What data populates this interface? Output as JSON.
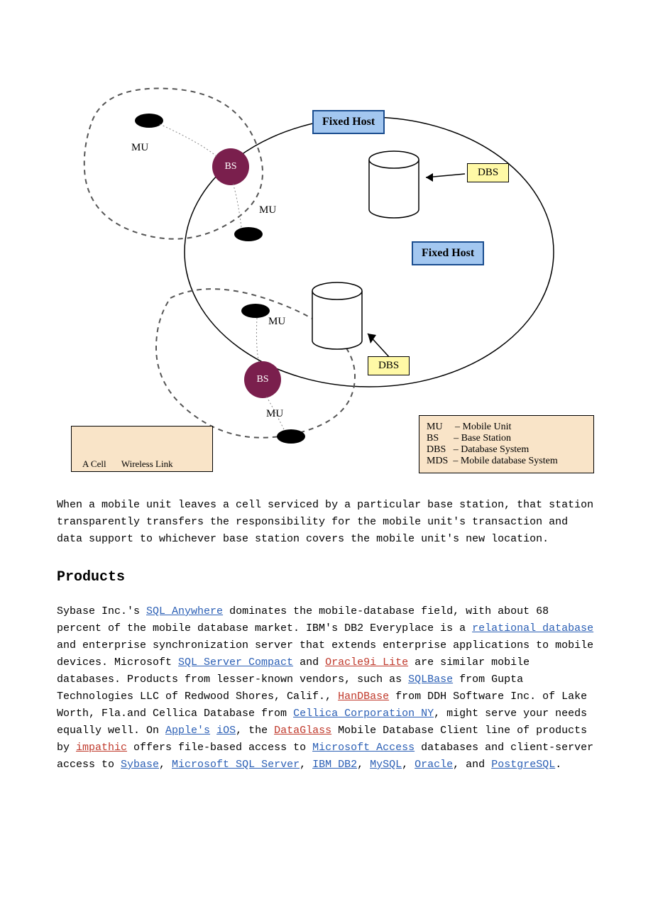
{
  "diagram": {
    "fixed_host": "Fixed Host",
    "mu": "MU",
    "bs": "BS",
    "dbs": "DBS",
    "legend_left": {
      "cell": "A Cell",
      "wireless": "Wireless Link"
    },
    "legend_right": {
      "mu": "MU     – Mobile Unit",
      "bs": "BS      – Base Station",
      "dbs": "DBS   – Database System",
      "mds": "MDS  – Mobile database System"
    }
  },
  "para1": "When a mobile unit leaves a cell serviced by a particular base station, that station transparently transfers the responsibility for the mobile unit's transaction and data support to whichever base station covers the mobile unit's new location.",
  "heading": "Products",
  "para2": {
    "t1": "Sybase Inc.'s ",
    "l1": "SQL Anywhere",
    "t2": " dominates the mobile-database field, with about 68 percent of the mobile database market. IBM's DB2 Everyplace is a ",
    "l2": "relational database",
    "t3": " and enterprise synchronization server that extends enterprise applications to mobile devices. Microsoft ",
    "l3": "SQL Server Compact",
    "t4": " and ",
    "l4": "Oracle9i Lite",
    "t5": " are similar mobile databases. Products from lesser-known vendors, such as ",
    "l5": "SQLBase",
    "t6": " from Gupta Technologies LLC of Redwood Shores, Calif., ",
    "l6": "HanDBase",
    "t7": " from DDH Software Inc. of Lake Worth, Fla.and Cellica Database from ",
    "l7": "Cellica Corporation NY",
    "t8": ", might serve your needs equally well. On ",
    "l8": "Apple's",
    "t8b": " ",
    "l9": "iOS",
    "t9": ", the ",
    "l10": "DataGlass",
    "t10": " Mobile Database Client line of products by ",
    "l11": "impathic",
    "t11": " offers file-based access to ",
    "l12": "Microsoft Access",
    "t12": " databases and client-server access to ",
    "l13": "Sybase",
    "t13": ", ",
    "l14": "Microsoft SQL Server",
    "t14": ", ",
    "l15": "IBM DB2",
    "t15": ", ",
    "l16": "MySQL",
    "t16": ", ",
    "l17": "Oracle",
    "t17": ", and ",
    "l18": "PostgreSQL",
    "t18": "."
  }
}
